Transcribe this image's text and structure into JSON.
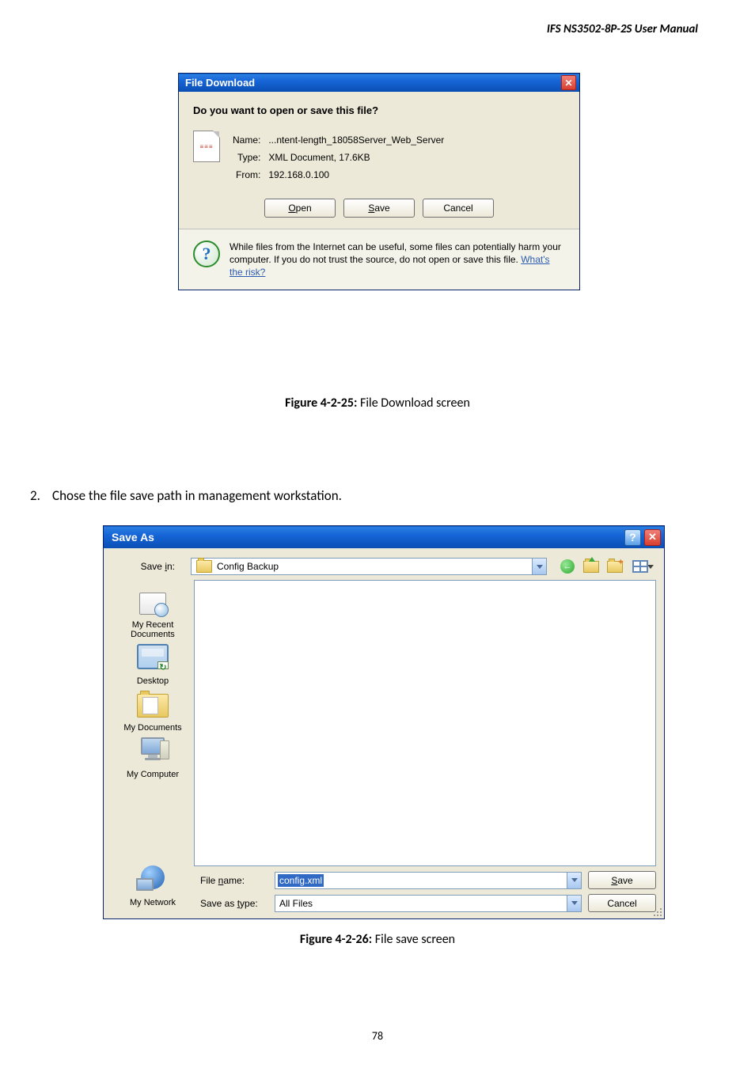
{
  "header": "IFS  NS3502-8P-2S  User  Manual",
  "download_dialog": {
    "title": "File Download",
    "heading": "Do you want to open or save this file?",
    "name_label": "Name:",
    "name_value": "...ntent-length_18058Server_Web_Server",
    "type_label": "Type:",
    "type_value": "XML Document, 17.6KB",
    "from_label": "From:",
    "from_value": "192.168.0.100",
    "open_btn": "Open",
    "save_btn": "Save",
    "cancel_btn": "Cancel",
    "warn_text_1": "While files from the Internet can be useful, some files can potentially harm your computer. If you do not trust the source, do not open or save this file. ",
    "risk_link": "What's the risk?"
  },
  "figure1_bold": "Figure 4-2-25:",
  "figure1_rest": " File Download screen",
  "step2_num": "2.",
  "step2_text": "Chose the file save path in management workstation.",
  "saveas": {
    "title": "Save As",
    "savein_label": "Save in:",
    "savein_value": "Config Backup",
    "places": {
      "recent": "My Recent Documents",
      "desktop": "Desktop",
      "documents": "My Documents",
      "computer": "My Computer",
      "network": "My Network"
    },
    "filename_label": "File name:",
    "filename_value": "config.xml",
    "savetype_label": "Save as type:",
    "savetype_value": "All Files",
    "save_btn": "Save",
    "cancel_btn": "Cancel"
  },
  "figure2_bold": "Figure 4-2-26:",
  "figure2_rest": " File save screen",
  "page_num": "78"
}
